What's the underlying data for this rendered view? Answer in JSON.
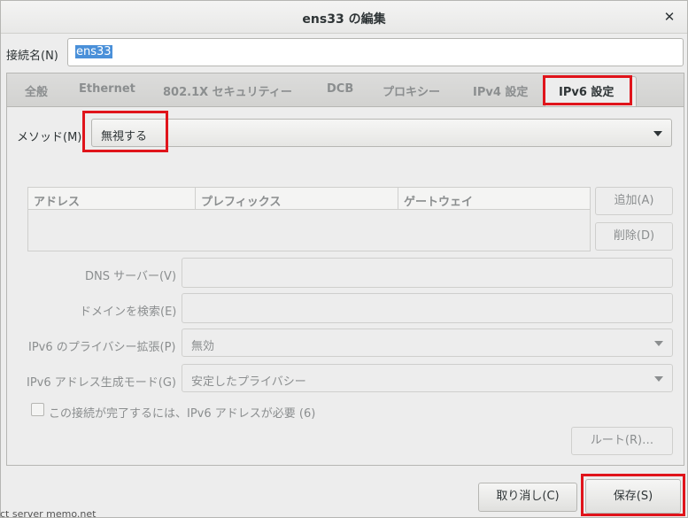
{
  "window": {
    "title": "ens33 の編集",
    "close_icon": "close-icon"
  },
  "connection": {
    "label": "接続名(N)",
    "value": "ens33"
  },
  "tabs": [
    {
      "label": "全般",
      "active": false
    },
    {
      "label": "Ethernet",
      "active": false
    },
    {
      "label": "802.1X セキュリティー",
      "active": false
    },
    {
      "label": "DCB",
      "active": false
    },
    {
      "label": "プロキシー",
      "active": false
    },
    {
      "label": "IPv4 設定",
      "active": false
    },
    {
      "label": "IPv6 設定",
      "active": true
    }
  ],
  "ipv6": {
    "method_label": "メソッド(M)",
    "method_value": "無視する",
    "address_table": {
      "columns": [
        "アドレス",
        "プレフィックス",
        "ゲートウェイ"
      ]
    },
    "add_button": "追加(A)",
    "delete_button": "削除(D)",
    "dns_label": "DNS サーバー(V)",
    "search_domain_label": "ドメインを検索(E)",
    "privacy_label": "IPv6 のプライバシー拡張(P)",
    "privacy_value": "無効",
    "addr_gen_label": "IPv6 アドレス生成モード(G)",
    "addr_gen_value": "安定したプライバシー",
    "required_checkbox_label": "この接続が完了するには、IPv6 アドレスが必要 (6)",
    "routes_button": "ルート(R)…"
  },
  "footer": {
    "cancel_button": "取り消し(C)",
    "save_button": "保存(S)"
  },
  "background_text": "ct server memo.net"
}
